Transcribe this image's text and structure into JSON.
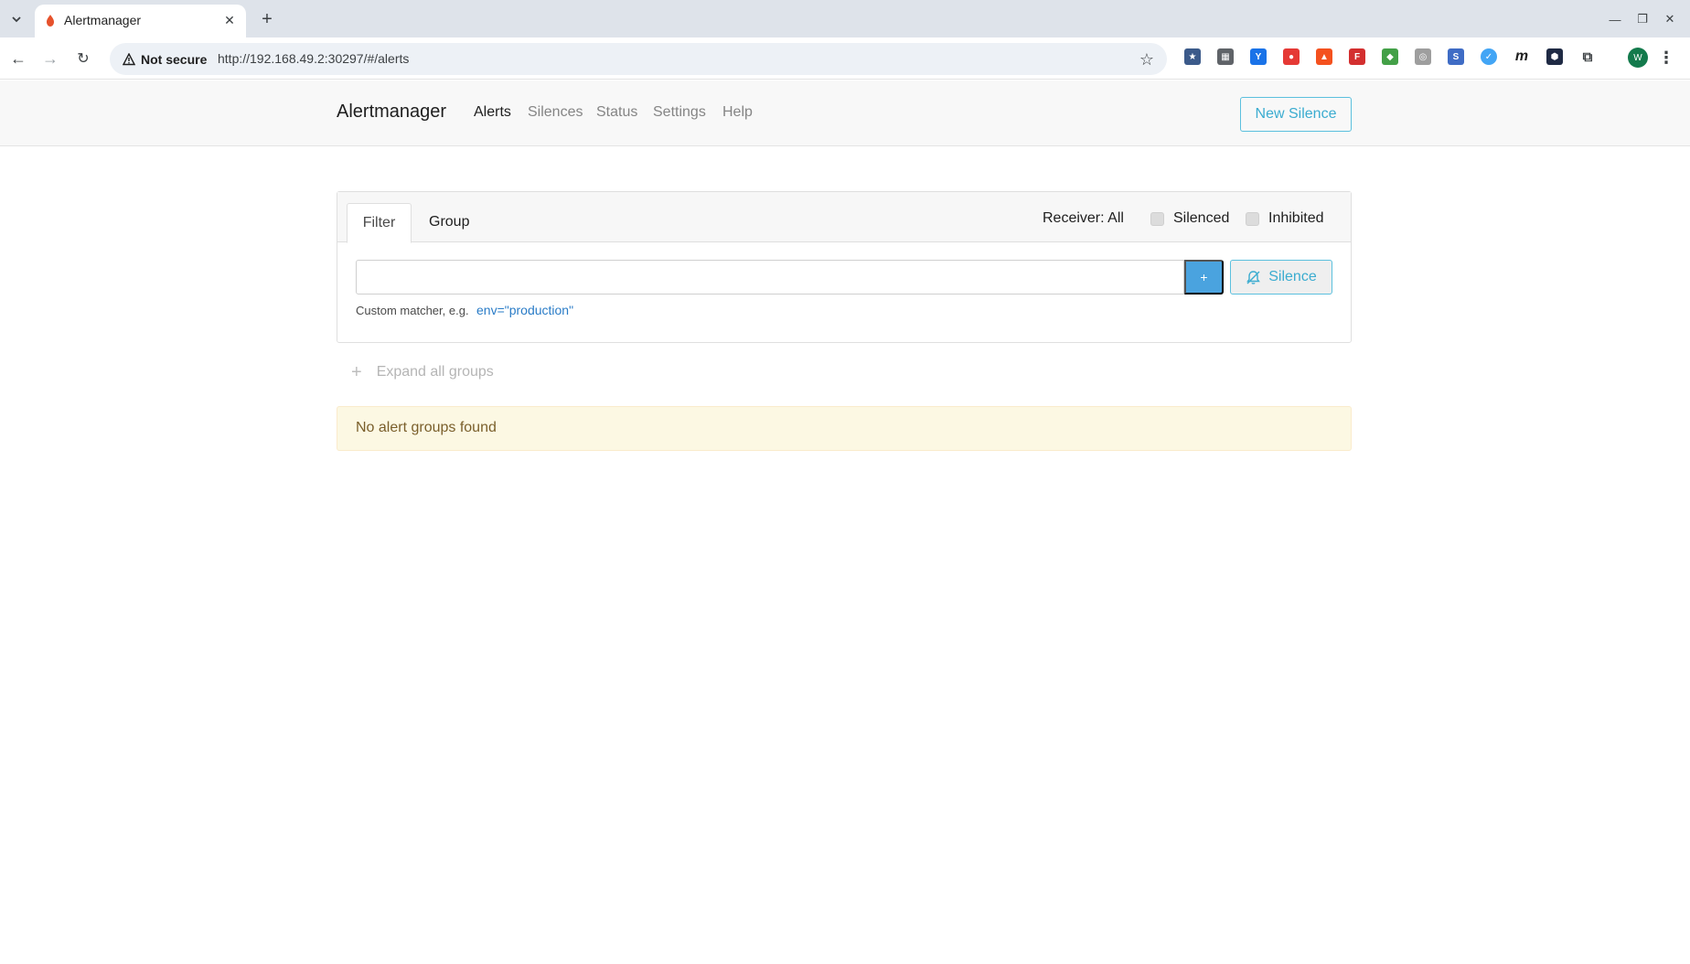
{
  "browser": {
    "tab_title": "Alertmanager",
    "security_label": "Not secure",
    "url": "http://192.168.49.2:30297/#/alerts",
    "profile_initial": "W"
  },
  "app": {
    "brand": "Alertmanager",
    "nav": {
      "alerts": "Alerts",
      "silences": "Silences",
      "status": "Status",
      "settings": "Settings",
      "help": "Help"
    },
    "new_silence_label": "New Silence"
  },
  "filter_panel": {
    "tabs": {
      "filter": "Filter",
      "group": "Group"
    },
    "receiver_label": "Receiver: All",
    "silenced_label": "Silenced",
    "inhibited_label": "Inhibited",
    "matcher_value": "",
    "add_label": "+",
    "silence_label": "Silence",
    "hint": "Custom matcher, e.g.",
    "hint_example": "env=\"production\""
  },
  "expand_label": "Expand all groups",
  "empty_message": "No alert groups found",
  "colors": {
    "accent": "#5bc0de",
    "primary": "#4aa3df",
    "warning_bg": "#fcf8e3"
  }
}
